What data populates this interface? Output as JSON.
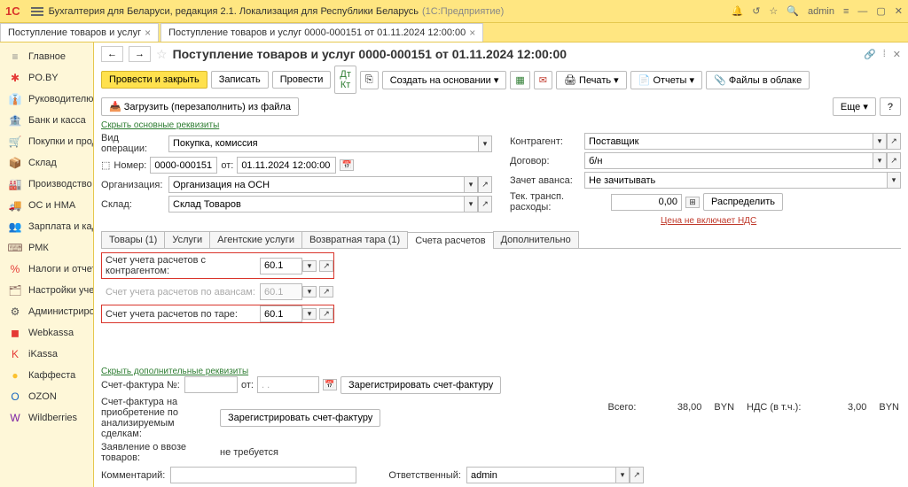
{
  "header": {
    "logo": "1С",
    "app_title": "Бухгалтерия для Беларуси, редакция 2.1. Локализация для Республики Беларусь",
    "app_sub": "(1С:Предприятие)",
    "user": "admin"
  },
  "tabs": [
    {
      "label": "Поступление товаров и услуг"
    },
    {
      "label": "Поступление товаров и услуг 0000-000151 от 01.11.2024 12:00:00"
    }
  ],
  "sidebar": [
    {
      "icon": "≡",
      "color": "#888",
      "label": "Главное"
    },
    {
      "icon": "✱",
      "color": "#e53935",
      "label": "PO.BY"
    },
    {
      "icon": "👔",
      "color": "#8d6e63",
      "label": "Руководителю"
    },
    {
      "icon": "🏦",
      "color": "#e53935",
      "label": "Банк и касса"
    },
    {
      "icon": "🛒",
      "color": "#8d6e63",
      "label": "Покупки и продажи"
    },
    {
      "icon": "📦",
      "color": "#8d6e63",
      "label": "Склад"
    },
    {
      "icon": "🏭",
      "color": "#8d6e63",
      "label": "Производство"
    },
    {
      "icon": "🚚",
      "color": "#555",
      "label": "ОС и НМА"
    },
    {
      "icon": "👥",
      "color": "#8d6e63",
      "label": "Зарплата и кадры"
    },
    {
      "icon": "⌨",
      "color": "#8d6e63",
      "label": "РМК"
    },
    {
      "icon": "%",
      "color": "#e53935",
      "label": "Налоги и отчетность"
    },
    {
      "icon": "🗂",
      "color": "#8d6e63",
      "label": "Настройки учета"
    },
    {
      "icon": "⚙",
      "color": "#555",
      "label": "Администрирование"
    },
    {
      "icon": "◼",
      "color": "#e53935",
      "label": "Webkassa"
    },
    {
      "icon": "K",
      "color": "#e53935",
      "label": "iKassa"
    },
    {
      "icon": "●",
      "color": "#fbc02d",
      "label": "Каффеста"
    },
    {
      "icon": "О",
      "color": "#1565c0",
      "label": "OZON"
    },
    {
      "icon": "W",
      "color": "#7b1fa2",
      "label": "Wildberries"
    }
  ],
  "doc": {
    "title": "Поступление товаров и услуг 0000-000151 от 01.11.2024 12:00:00",
    "buttons": {
      "post_close": "Провести и закрыть",
      "write": "Записать",
      "post": "Провести",
      "create_based": "Создать на основании",
      "print": "Печать",
      "reports": "Отчеты",
      "files_cloud": "Файлы в облаке",
      "load_refill": "Загрузить (перезаполнить) из файла",
      "more": "Еще"
    },
    "hide_main_req": "Скрыть основные реквизиты",
    "fields": {
      "op_type_lbl": "Вид операции:",
      "op_type": "Покупка, комиссия",
      "counterparty_lbl": "Контрагент:",
      "counterparty": "Поставщик",
      "number_lbl": "Номер:",
      "number": "0000-000151",
      "from_lbl": "от:",
      "date": "01.11.2024 12:00:00",
      "contract_lbl": "Договор:",
      "contract": "б/н",
      "org_lbl": "Организация:",
      "org": "Организация на ОСН",
      "advance_lbl": "Зачет аванса:",
      "advance": "Не зачитывать",
      "warehouse_lbl": "Склад:",
      "warehouse": "Склад Товаров",
      "transp_lbl": "Тек. трансп. расходы:",
      "transp_val": "0,00",
      "distribute": "Распределить",
      "vat_link": "Цена не включает НДС"
    },
    "detail_tabs": [
      "Товары (1)",
      "Услуги",
      "Агентские услуги",
      "Возвратная тара (1)",
      "Счета расчетов",
      "Дополнительно"
    ],
    "accounts": [
      {
        "label": "Счет учета расчетов с контрагентом:",
        "value": "60.1",
        "highlight": true,
        "disabled": false
      },
      {
        "label": "Счет учета расчетов по авансам:",
        "value": "60.1",
        "highlight": false,
        "disabled": true
      },
      {
        "label": "Счет учета расчетов по таре:",
        "value": "60.1",
        "highlight": true,
        "disabled": false
      }
    ],
    "totals": {
      "total_lbl": "Всего:",
      "total_val": "38,00",
      "currency": "BYN",
      "vat_lbl": "НДС (в т.ч.):",
      "vat_val": "3,00"
    },
    "bottom": {
      "hide_extra": "Скрыть дополнительные реквизиты",
      "invoice_no_lbl": "Счет-фактура №:",
      "from2_lbl": "от:",
      "date2": ". .",
      "reg_invoice": "Зарегистрировать счет-фактуру",
      "invoice_purchase": "Счет-фактура на приобретение по анализируемым сделкам:",
      "reg_invoice2": "Зарегистрировать счет-фактуру",
      "import_decl_lbl": "Заявление о ввозе товаров:",
      "import_decl_val": "не требуется",
      "comment_lbl": "Комментарий:",
      "responsible_lbl": "Ответственный:",
      "responsible": "admin"
    }
  }
}
